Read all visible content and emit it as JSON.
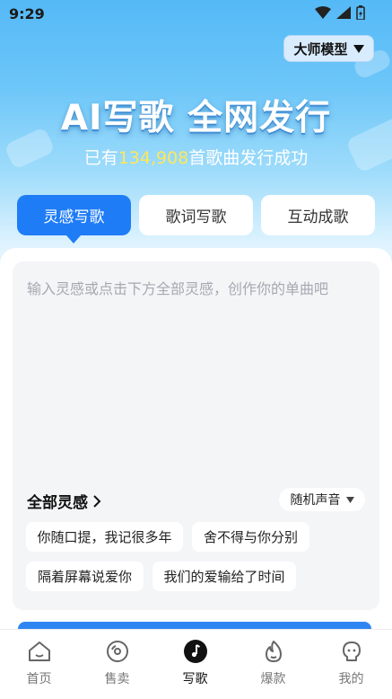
{
  "status": {
    "time": "9:29"
  },
  "header": {
    "model_label": "大师模型",
    "model_icon": "triangle-down"
  },
  "hero": {
    "headline": "AI写歌 全网发行",
    "sub_prefix": "已有",
    "sub_count": "134,908",
    "sub_suffix": "首歌曲发行成功"
  },
  "tabs": [
    {
      "label": "灵感写歌",
      "active": true
    },
    {
      "label": "歌词写歌",
      "active": false
    },
    {
      "label": "互动成歌",
      "active": false
    }
  ],
  "editor": {
    "placeholder": "输入灵感或点击下方全部灵感，创作你的单曲吧"
  },
  "inspiration": {
    "title": "全部灵感",
    "voice_label": "随机声音",
    "chips": [
      "你随口提，我记很多年",
      "舍不得与你分别",
      "隔着屏幕说爱你",
      "我们的爱输给了时间"
    ]
  },
  "nav": [
    {
      "label": "首页",
      "icon": "home-icon"
    },
    {
      "label": "售卖",
      "icon": "disc-icon"
    },
    {
      "label": "写歌",
      "icon": "music-note-icon",
      "active": true
    },
    {
      "label": "爆款",
      "icon": "flame-icon"
    },
    {
      "label": "我的",
      "icon": "profile-icon"
    }
  ],
  "colors": {
    "accent": "#1e7cf7",
    "highlight": "#ffe75a"
  }
}
